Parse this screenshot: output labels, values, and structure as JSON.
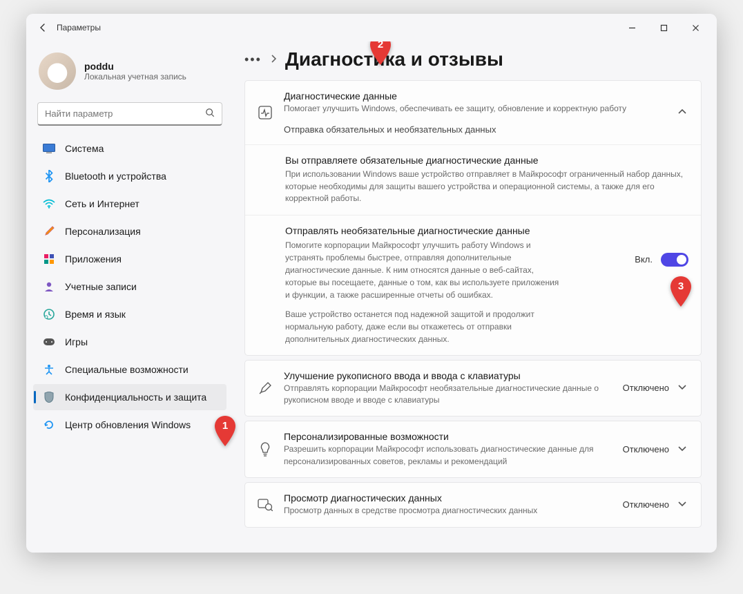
{
  "window": {
    "app_title": "Параметры"
  },
  "profile": {
    "name": "poddu",
    "subtitle": "Локальная учетная запись"
  },
  "search": {
    "placeholder": "Найти параметр"
  },
  "nav": {
    "items": [
      {
        "icon": "system-icon",
        "label": "Система"
      },
      {
        "icon": "bluetooth-icon",
        "label": "Bluetooth и устройства"
      },
      {
        "icon": "wifi-icon",
        "label": "Сеть и Интернет"
      },
      {
        "icon": "brush-icon",
        "label": "Персонализация"
      },
      {
        "icon": "apps-icon",
        "label": "Приложения"
      },
      {
        "icon": "accounts-icon",
        "label": "Учетные записи"
      },
      {
        "icon": "clock-icon",
        "label": "Время и язык"
      },
      {
        "icon": "games-icon",
        "label": "Игры"
      },
      {
        "icon": "accessibility-icon",
        "label": "Специальные возможности"
      },
      {
        "icon": "shield-icon",
        "label": "Конфиденциальность и защита"
      },
      {
        "icon": "update-icon",
        "label": "Центр обновления Windows"
      }
    ],
    "selected_index": 9
  },
  "breadcrumb": {
    "title": "Диагностика и отзывы"
  },
  "sections": {
    "diag_data": {
      "title": "Диагностические данные",
      "desc": "Помогает улучшить Windows, обеспечивать ее защиту, обновление и корректную работу",
      "status_line": "Отправка обязательных и необязательных данных"
    },
    "required": {
      "title": "Вы отправляете обязательные диагностические данные",
      "desc": "При использовании Windows ваше устройство отправляет в Майкрософт ограниченный набор данных, которые необходимы для защиты вашего устройства и операционной системы, а также для его корректной работы."
    },
    "optional": {
      "title": "Отправлять необязательные диагностические данные",
      "desc": "Помогите корпорации Майкрософт улучшить работу Windows и устранять проблемы быстрее, отправляя дополнительные диагностические данные. К ним относятся данные о веб-сайтах, которые вы посещаете, данные о том, как вы используете приложения и функции, а также расширенные отчеты об ошибках.",
      "desc2": "Ваше устройство останется под надежной защитой и продолжит нормальную работу, даже если вы откажетесь от отправки дополнительных диагностических данных.",
      "toggle_state": "Вкл."
    },
    "inking": {
      "title": "Улучшение рукописного ввода и ввода с клавиатуры",
      "desc": "Отправлять корпорации Майкрософт необязательные диагностические данные о рукописном вводе и вводе с клавиатуры",
      "status": "Отключено"
    },
    "tailored": {
      "title": "Персонализированные возможности",
      "desc": "Разрешить корпорации Майкрософт использовать диагностические данные для персонализированных советов, рекламы и рекомендаций",
      "status": "Отключено"
    },
    "view": {
      "title": "Просмотр диагностических данных",
      "desc": "Просмотр данных в средстве просмотра диагностических данных",
      "status": "Отключено"
    }
  },
  "annotations": {
    "pin1": "1",
    "pin2": "2",
    "pin3": "3"
  }
}
